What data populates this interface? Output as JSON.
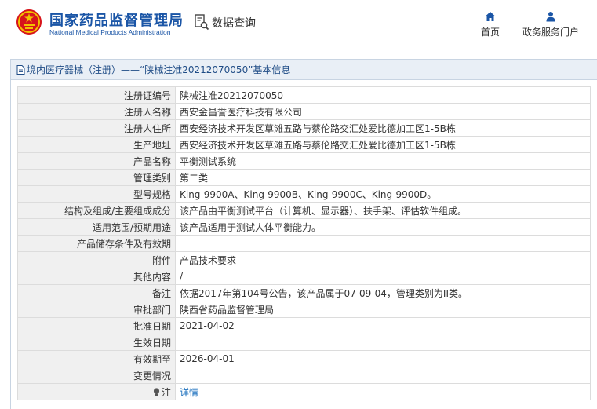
{
  "header": {
    "title": "国家药品监督管理局",
    "subtitle": "National Medical Products Administration",
    "data_query": "数据查询",
    "nav": [
      {
        "label": "首页",
        "icon": "home-icon"
      },
      {
        "label": "政务服务门户",
        "icon": "user-icon"
      }
    ]
  },
  "panel": {
    "heading": "境内医疗器械（注册）——“陕械注准20212070050”基本信息",
    "heading_icon": "document-icon"
  },
  "records": [
    {
      "label": "注册证编号",
      "value": "陕械注准20212070050"
    },
    {
      "label": "注册人名称",
      "value": "西安金昌誉医疗科技有限公司"
    },
    {
      "label": "注册人住所",
      "value": "西安经济技术开发区草滩五路与蔡伦路交汇处爱比德加工区1-5B栋"
    },
    {
      "label": "生产地址",
      "value": "西安经济技术开发区草滩五路与蔡伦路交汇处爱比德加工区1-5B栋"
    },
    {
      "label": "产品名称",
      "value": "平衡测试系统"
    },
    {
      "label": "管理类别",
      "value": "第二类"
    },
    {
      "label": "型号规格",
      "value": "King-9900A、King-9900B、King-9900C、King-9900D。"
    },
    {
      "label": "结构及组成/主要组成成分",
      "value": "该产品由平衡测试平台（计算机、显示器）、扶手架、评估软件组成。"
    },
    {
      "label": "适用范围/预期用途",
      "value": "该产品适用于测试人体平衡能力。"
    },
    {
      "label": "产品储存条件及有效期",
      "value": ""
    },
    {
      "label": "附件",
      "value": "产品技术要求"
    },
    {
      "label": "其他内容",
      "value": "/"
    },
    {
      "label": "备注",
      "value": "依据2017年第104号公告，该产品属于07-09-04，管理类别为II类。"
    },
    {
      "label": "审批部门",
      "value": "陕西省药品监督管理局"
    },
    {
      "label": "批准日期",
      "value": "2021-04-02"
    },
    {
      "label": "生效日期",
      "value": ""
    },
    {
      "label": "有效期至",
      "value": "2026-04-01"
    },
    {
      "label": "变更情况",
      "value": ""
    }
  ],
  "note_row": {
    "label": "注",
    "link": "详情",
    "icon": "bulb-icon"
  },
  "colors": {
    "brand_blue": "#1a55a6",
    "emblem_red": "#d7141b",
    "emblem_gold": "#f2c200",
    "link": "#1a6fbd"
  }
}
